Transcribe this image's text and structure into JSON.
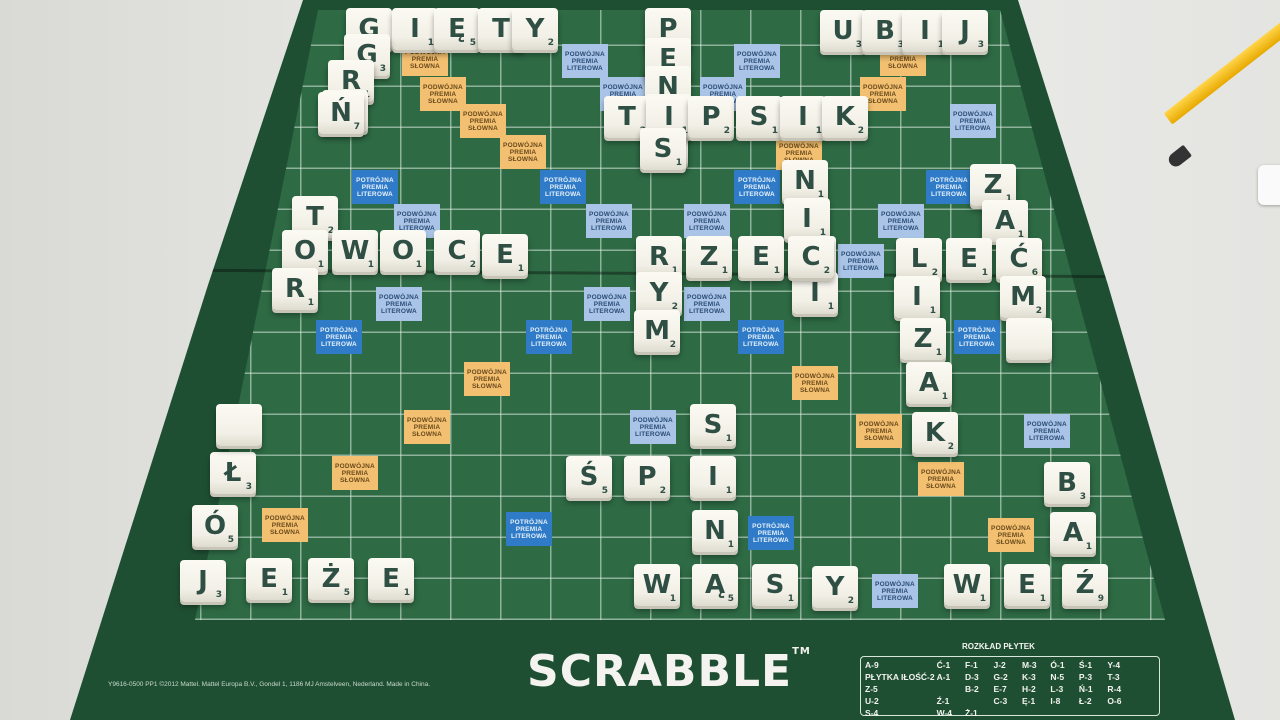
{
  "game": "Scrabble",
  "logo": "SCRABBLE",
  "logo_tm": "TM",
  "legal_text": "Y9616-0500 PP1 ©2012 Mattel. Mattel Europa B.V., Gondel 1, 1186 MJ Amstelveen, Nederland. Made in China.",
  "premium_labels": {
    "dw": "PODWÓJNA PREMIA SŁOWNA",
    "dl": "PODWÓJNA PREMIA LITEROWA",
    "tl": "POTRÓJNA PREMIA LITEROWA"
  },
  "tile_distribution_title": "ROZKŁAD PŁYTEK",
  "tile_distribution": [
    [
      "A-9",
      "Ć-1",
      "F-1",
      "J-2",
      "M-3",
      "Ó-1",
      "Ś-1",
      "Y-4",
      "PŁYTKA IŁOŚĆ-2"
    ],
    [
      "A-1",
      "D-3",
      "G-2",
      "K-3",
      "N-5",
      "P-3",
      "T-3",
      "Z-5",
      ""
    ],
    [
      "B-2",
      "E-7",
      "H-2",
      "L-3",
      "Ń-1",
      "R-4",
      "U-2",
      "Ź-1",
      ""
    ],
    [
      "C-3",
      "Ę-1",
      "I-8",
      "Ł-2",
      "O-6",
      "S-4",
      "W-4",
      "Ż-1",
      ""
    ]
  ],
  "tiles": [
    {
      "l": "G",
      "p": "3"
    },
    {
      "l": "I",
      "p": "1"
    },
    {
      "l": "Ę",
      "p": "5"
    },
    {
      "l": "T",
      "p": "2"
    },
    {
      "l": "Y",
      "p": "2"
    },
    {
      "l": "P",
      "p": "2"
    },
    {
      "l": "E",
      "p": "1"
    },
    {
      "l": "N",
      "p": "1"
    },
    {
      "l": "I",
      "p": "1"
    },
    {
      "l": "S",
      "p": "1"
    },
    {
      "l": "U",
      "p": "3"
    },
    {
      "l": "B",
      "p": "3"
    },
    {
      "l": "I",
      "p": "1"
    },
    {
      "l": "J",
      "p": "3"
    },
    {
      "l": "G",
      "p": "3"
    },
    {
      "l": "R",
      "p": "1"
    },
    {
      "l": "A",
      "p": "1"
    },
    {
      "l": "Ń",
      "p": "7"
    },
    {
      "l": "T",
      "p": "2"
    },
    {
      "l": "I",
      "p": "1"
    },
    {
      "l": "P",
      "p": "2"
    },
    {
      "l": "S",
      "p": "1"
    },
    {
      "l": "I",
      "p": "1"
    },
    {
      "l": "K",
      "p": "2"
    },
    {
      "l": "S",
      "p": "1"
    },
    {
      "l": "N",
      "p": "1"
    },
    {
      "l": "I",
      "p": "1"
    },
    {
      "l": "C",
      "p": "2"
    },
    {
      "l": "I",
      "p": "1"
    },
    {
      "l": "Z",
      "p": "1"
    },
    {
      "l": "A",
      "p": "1"
    },
    {
      "l": "T",
      "p": "2"
    },
    {
      "l": "O",
      "p": "1"
    },
    {
      "l": "R",
      "p": "1"
    },
    {
      "l": "W",
      "p": "1"
    },
    {
      "l": "O",
      "p": "1"
    },
    {
      "l": "C",
      "p": "2"
    },
    {
      "l": "E",
      "p": "1"
    },
    {
      "l": "R",
      "p": "1"
    },
    {
      "l": "Z",
      "p": "1"
    },
    {
      "l": "E",
      "p": "1"
    },
    {
      "l": "C",
      "p": "2"
    },
    {
      "l": "Y",
      "p": "2"
    },
    {
      "l": "M",
      "p": "2"
    },
    {
      "l": "L",
      "p": "2"
    },
    {
      "l": "E",
      "p": "1"
    },
    {
      "l": "Ć",
      "p": "6"
    },
    {
      "l": "M",
      "p": "2"
    },
    {
      "l": "I",
      "p": "1"
    },
    {
      "l": "Z",
      "p": "1"
    },
    {
      "l": "A",
      "p": "1"
    },
    {
      "l": "K",
      "p": "2"
    },
    {
      "l": "S",
      "p": "1"
    },
    {
      "l": "Ś",
      "p": "5"
    },
    {
      "l": "P",
      "p": "2"
    },
    {
      "l": "I",
      "p": "1"
    },
    {
      "l": "N",
      "p": "1"
    },
    {
      "l": "Ł",
      "p": "3"
    },
    {
      "l": "Ó",
      "p": "5"
    },
    {
      "l": "J",
      "p": "3"
    },
    {
      "l": "E",
      "p": "1"
    },
    {
      "l": "Ż",
      "p": "5"
    },
    {
      "l": "E",
      "p": "1"
    },
    {
      "l": "W",
      "p": "1"
    },
    {
      "l": "Ą",
      "p": "5"
    },
    {
      "l": "S",
      "p": "1"
    },
    {
      "l": "Y",
      "p": "2"
    },
    {
      "l": "W",
      "p": "1"
    },
    {
      "l": "E",
      "p": "1"
    },
    {
      "l": "Ź",
      "p": "9"
    },
    {
      "l": "B",
      "p": "3"
    },
    {
      "l": "A",
      "p": "1"
    }
  ]
}
